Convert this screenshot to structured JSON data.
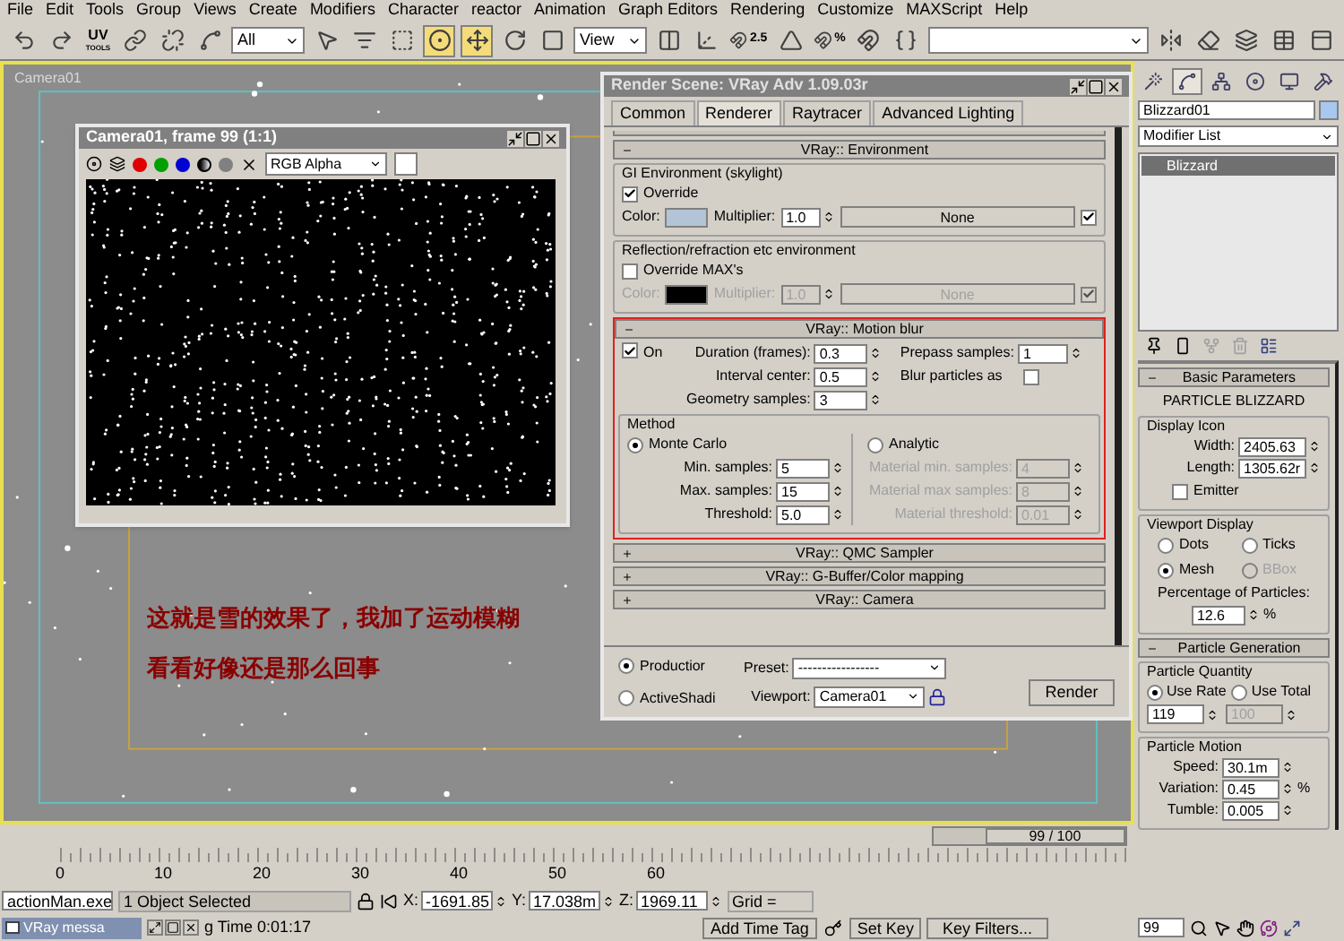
{
  "menu_bar": [
    "File",
    "Edit",
    "Tools",
    "Group",
    "Views",
    "Create",
    "Modifiers",
    "Character",
    "reactor",
    "Animation",
    "Graph Editors",
    "Rendering",
    "Customize",
    "MAXScript",
    "Help"
  ],
  "toolbar": [
    {
      "kind": "undo",
      "selected": false
    },
    {
      "kind": "redo",
      "selected": false
    },
    {
      "kind": "uv",
      "label": "UV",
      "sublabel": "TOOLS"
    },
    {
      "kind": "link",
      "selected": false
    },
    {
      "kind": "unlink",
      "selected": false
    },
    {
      "kind": "bind",
      "selected": false
    },
    {
      "kind": "dropdown",
      "value": "All"
    },
    {
      "kind": "select",
      "selected": false
    },
    {
      "kind": "select-name",
      "selected": false
    },
    {
      "kind": "rect-region",
      "selected": false
    },
    {
      "kind": "crossing",
      "selected": true
    },
    {
      "kind": "move",
      "selected": true
    },
    {
      "kind": "rotate",
      "selected": false
    },
    {
      "kind": "scale",
      "selected": false
    },
    {
      "kind": "dropdown",
      "value": "View"
    },
    {
      "kind": "pivot",
      "selected": false
    },
    {
      "kind": "manipulate",
      "selected": false
    },
    {
      "kind": "snap",
      "label": "2.5",
      "selected": false
    },
    {
      "kind": "angle-snap",
      "selected": false
    },
    {
      "kind": "snap",
      "label": "%",
      "selected": false
    },
    {
      "kind": "spinner-snap",
      "selected": false
    },
    {
      "kind": "named-sets",
      "selected": false
    },
    {
      "kind": "blank-dropdown"
    },
    {
      "kind": "mirror",
      "selected": false
    },
    {
      "kind": "align",
      "selected": false
    },
    {
      "kind": "layers",
      "selected": false
    },
    {
      "kind": "curve-editor",
      "selected": false
    },
    {
      "kind": "schematic",
      "selected": false
    }
  ],
  "viewport": {
    "label": "Camera01"
  },
  "frame_window": {
    "title": "Camera01, frame 99 (1:1)",
    "channel": "RGB Alpha"
  },
  "annotation": [
    "这就是雪的效果了，我加了运动模糊",
    "看看好像还是那么回事"
  ],
  "render_dialog": {
    "title": "Render Scene: VRay Adv 1.09.03r",
    "tabs": [
      {
        "label": "Common",
        "selected": false
      },
      {
        "label": "Renderer",
        "selected": true
      },
      {
        "label": "Raytracer",
        "selected": false
      },
      {
        "label": "Advanced Lighting",
        "selected": false
      }
    ],
    "environment": {
      "header": "VRay:: Environment",
      "expanded": true,
      "groups": [
        {
          "title": "GI Environment (skylight)",
          "override_label": "Override",
          "override": true,
          "color_label": "Color:",
          "color": "#b4c4d8",
          "multiplier_label": "Multiplier:",
          "multiplier": "1.0",
          "map": "None",
          "map_on": true
        },
        {
          "title": "Reflection/refraction etc environment",
          "override_label": "Override MAX's",
          "override": false,
          "color_label": "Color:",
          "color": "#000000",
          "multiplier_label": "Multiplier:",
          "multiplier": "1.0",
          "map": "None",
          "map_on": true
        }
      ]
    },
    "motion_blur": {
      "header": "VRay:: Motion blur",
      "expanded": true,
      "highlighted": true,
      "on_label": "On",
      "on": true,
      "left_fields": [
        {
          "label": "Duration (frames):",
          "value": "0.3"
        },
        {
          "label": "Interval center:",
          "value": "0.5"
        },
        {
          "label": "Geometry samples:",
          "value": "3"
        }
      ],
      "prepass": {
        "label": "Prepass samples:",
        "value": "1"
      },
      "blur_particles": {
        "label": "Blur particles as",
        "checked": false
      },
      "method_title": "Method",
      "methods": [
        {
          "label": "Monte Carlo",
          "selected": true,
          "fields": [
            {
              "label": "Min. samples:",
              "value": "5"
            },
            {
              "label": "Max. samples:",
              "value": "15"
            },
            {
              "label": "Threshold:",
              "value": "5.0"
            }
          ]
        },
        {
          "label": "Analytic",
          "selected": false,
          "fields": [
            {
              "label": "Material min. samples:",
              "value": "4"
            },
            {
              "label": "Material max samples:",
              "value": "8"
            },
            {
              "label": "Material threshold:",
              "value": "0.01"
            }
          ]
        }
      ]
    },
    "collapsed_rollouts": [
      {
        "label": "VRay:: QMC Sampler",
        "expanded": false
      },
      {
        "label": "VRay:: G-Buffer/Color mapping",
        "expanded": false
      },
      {
        "label": "VRay:: Camera",
        "expanded": false
      }
    ],
    "mode": [
      {
        "label": "Productior",
        "selected": true
      },
      {
        "label": "ActiveShadi",
        "selected": false
      }
    ],
    "preset": {
      "label": "Preset:",
      "value": "-----------------"
    },
    "viewport": {
      "label": "Viewport:",
      "value": "Camera01"
    },
    "render_button": "Render"
  },
  "command_panel": {
    "tabs": [
      {
        "kind": "create",
        "selected": false
      },
      {
        "kind": "modify",
        "selected": true
      },
      {
        "kind": "hierarchy",
        "selected": false
      },
      {
        "kind": "motion",
        "selected": false
      },
      {
        "kind": "display",
        "selected": false
      },
      {
        "kind": "utilities",
        "selected": false
      }
    ],
    "object_name": "Blizzard01",
    "modifier_list": "Modifier List",
    "stack": [
      {
        "label": "Blizzard",
        "selected": true
      }
    ],
    "basic_parameters": {
      "header": "Basic Parameters",
      "expanded": true,
      "title": "PARTICLE BLIZZARD",
      "display_icon_title": "Display Icon",
      "fields": [
        {
          "label": "Width:",
          "value": "2405.63"
        },
        {
          "label": "Length:",
          "value": "1305.62r"
        }
      ],
      "emitter": {
        "label": "Emitter",
        "checked": false
      },
      "viewport_display_title": "Viewport Display",
      "display_modes": [
        {
          "label": "Dots",
          "selected": false,
          "disabled": false
        },
        {
          "label": "Ticks",
          "selected": false,
          "disabled": false
        },
        {
          "label": "Mesh",
          "selected": true,
          "disabled": false
        },
        {
          "label": "BBox",
          "selected": false,
          "disabled": true
        }
      ],
      "percentage_label": "Percentage of Particles:",
      "percentage": "12.6",
      "percent_sign": "%"
    },
    "particle_generation": {
      "header": "Particle Generation",
      "expanded": true,
      "quantity_title": "Particle Quantity",
      "quantity_modes": [
        {
          "label": "Use Rate",
          "selected": true
        },
        {
          "label": "Use Total",
          "selected": false
        }
      ],
      "rate": "119",
      "total": "100",
      "motion_title": "Particle Motion",
      "motion_fields": [
        {
          "label": "Speed:",
          "value": "30.1m"
        },
        {
          "label": "Variation:",
          "value": "0.45",
          "unit": "%"
        },
        {
          "label": "Tumble:",
          "value": "0.005"
        }
      ]
    }
  },
  "time_slider": {
    "label": "99 / 100",
    "level": 0.99
  },
  "ruler_ticks": [
    "0",
    "10",
    "20",
    "30",
    "40",
    "50",
    "60"
  ],
  "status": {
    "maxscript": "actionMan.exe",
    "minimized_window": "VRay messa",
    "selection": "1 Object Selected",
    "coords": [
      {
        "axis": "X:",
        "value": "-1691.85"
      },
      {
        "axis": "Y:",
        "value": "17.038m"
      },
      {
        "axis": "Z:",
        "value": "1969.11"
      }
    ],
    "grid": "Grid =",
    "prompt": "g Time  0:01:17",
    "add_time_tag": "Add Time Tag",
    "set_key": "Set Key",
    "key_filters": "Key Filters...",
    "frame": "99"
  }
}
